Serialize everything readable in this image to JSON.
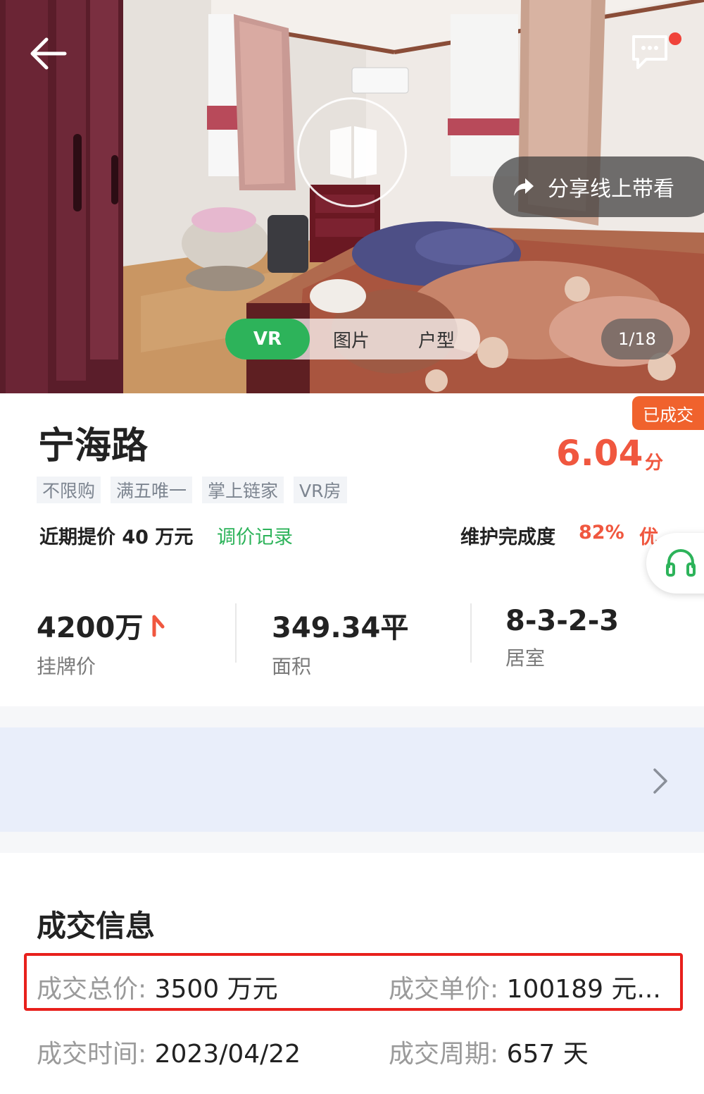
{
  "hero": {
    "share_label": "分享线上带看",
    "media_tabs": [
      "VR",
      "图片",
      "户型"
    ],
    "photo_counter": "1/18"
  },
  "listing": {
    "status_badge": "已成交",
    "title": "宁海路",
    "score": "6.04",
    "score_unit": "分",
    "tags": [
      "不限购",
      "满五唯一",
      "掌上链家",
      "VR房"
    ],
    "recent_change": "近期提价 40 万元",
    "price_history_link": "调价记录",
    "maintenance_label": "维护完成度",
    "maintenance_percent": "82%",
    "maintenance_grade": "优"
  },
  "stats": [
    {
      "value": "4200万",
      "label": "挂牌价"
    },
    {
      "value": "349.34平",
      "label": "面积"
    },
    {
      "value": "8-3-2-3",
      "label": "居室"
    }
  ],
  "deal": {
    "section_title": "成交信息",
    "total_price_label": "成交总价: ",
    "total_price_value": "3500 万元",
    "unit_price_label": "成交单价: ",
    "unit_price_value": "100189 元...",
    "deal_date_label": "成交时间: ",
    "deal_date_value": "2023/04/22",
    "deal_cycle_label": "成交周期: ",
    "deal_cycle_value": "657 天"
  },
  "colors": {
    "accent_green": "#2db35a",
    "accent_red": "#f0573f",
    "badge_orange": "#f0622d",
    "highlight_red": "#e8201c",
    "banner_bg": "#e9eefa"
  },
  "icons": [
    "back-arrow-icon",
    "message-icon",
    "vr-icon",
    "share-arrow-icon",
    "price-up-arrow-icon",
    "headset-icon",
    "chevron-right-icon"
  ]
}
